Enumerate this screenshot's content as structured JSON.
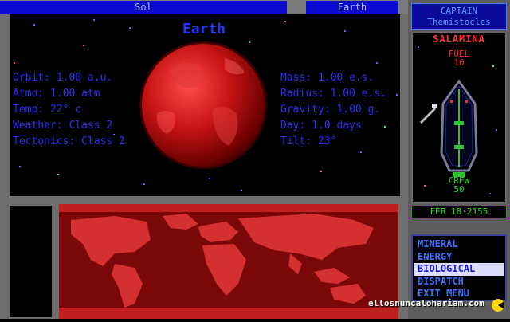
{
  "header": {
    "system": "Sol",
    "planet": "Earth"
  },
  "planet": {
    "title": "Earth",
    "left_stats": [
      "Orbit: 1.00 a.u.",
      "Atmo: 1.00 atm",
      "Temp: 22° c",
      "Weather: Class 2",
      "Tectonics: Class 2"
    ],
    "right_stats": [
      "Mass: 1.00 e.s.",
      "Radius: 1.00 e.s.",
      "Gravity: 1.00 g.",
      "Day: 1.0 days",
      "Tilt: 23°"
    ]
  },
  "sidebar": {
    "captain_label": "CAPTAIN",
    "captain_name": "Themistocles",
    "ship_name": "SALAMINA",
    "fuel_label": "FUEL",
    "fuel_value": "10",
    "crew_label": "CREW",
    "crew_value": "50",
    "date": "FEB 18·2155",
    "menu": [
      "MINERAL",
      "ENERGY",
      "BIOLOGICAL",
      "DISPATCH",
      "EXIT MENU"
    ],
    "selected_menu": "BIOLOGICAL"
  },
  "watermark": "ellosnuncalohariam.com",
  "colors": {
    "frame": "#6e6e6e",
    "text_blue": "#2d2dff",
    "planet_red": "#c81414",
    "fuel_red": "#ff2a2a",
    "crew_green": "#2fd62f"
  }
}
